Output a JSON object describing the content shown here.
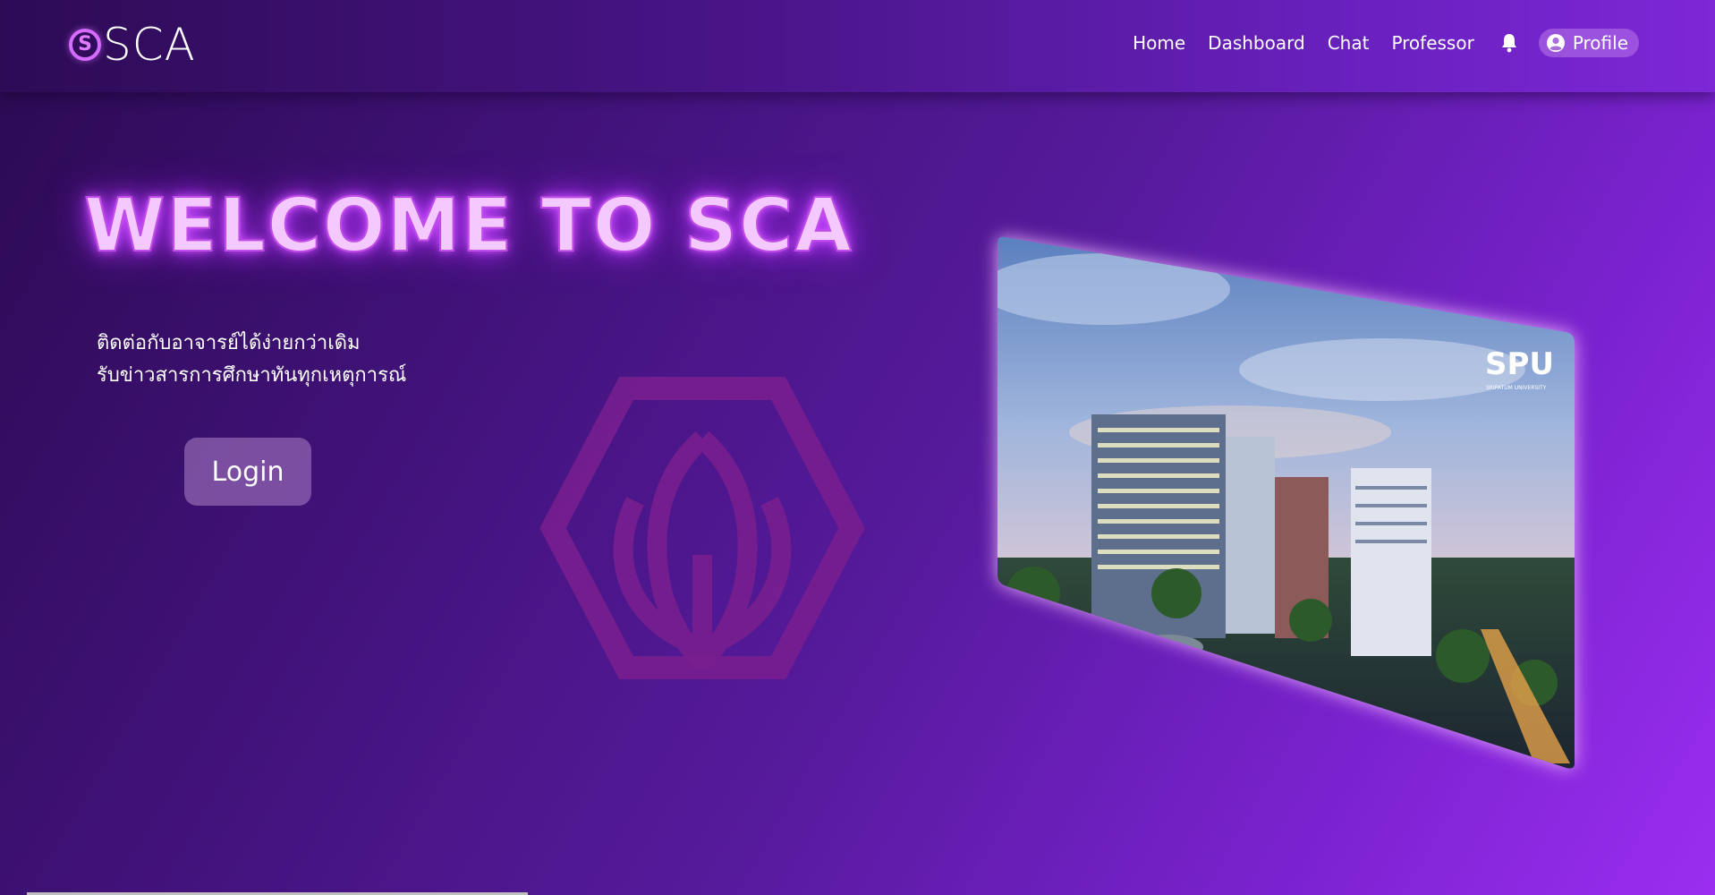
{
  "brand": {
    "logo_letter": "S",
    "name": "SCA"
  },
  "nav": {
    "links": [
      "Home",
      "Dashboard",
      "Chat",
      "Professor"
    ],
    "notification_icon": "bell-icon",
    "profile_icon": "user-circle-icon",
    "profile_label": "Profile"
  },
  "hero": {
    "title": "WELCOME TO SCA",
    "tagline_line1": "ติดต่อกับอาจารย์ได้ง่ายกว่าเดิม",
    "tagline_line2": "รับข่าวสารการศึกษาทันทุกเหตุการณ์",
    "login_label": "Login"
  },
  "campus_image": {
    "logo_text": "SPU",
    "logo_subtext": "SRIPATUM UNIVERSITY"
  },
  "colors": {
    "accent": "#d66cff",
    "title_glow": "#b634ff",
    "bg_start": "#2b0a52",
    "bg_end": "#9b2ef0",
    "watermark": "#7a1f8f"
  }
}
